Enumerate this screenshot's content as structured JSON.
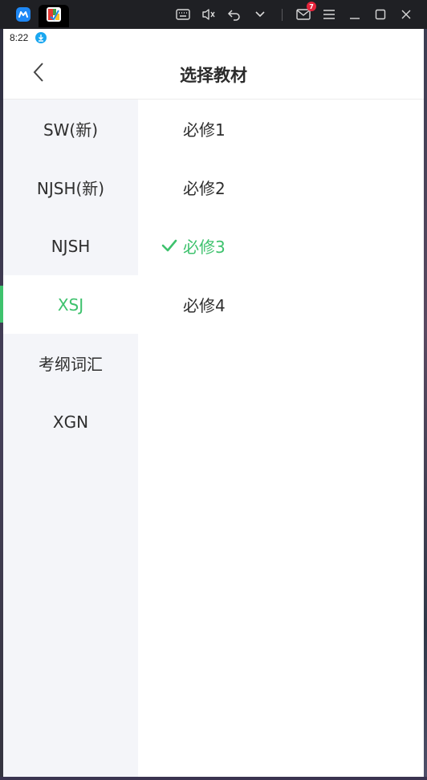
{
  "emulator": {
    "notification_count": "7"
  },
  "status_bar": {
    "time": "8:22"
  },
  "header": {
    "title": "选择教材"
  },
  "sidebar": {
    "items": [
      {
        "label": "SW(新)",
        "active": false
      },
      {
        "label": "NJSH(新)",
        "active": false
      },
      {
        "label": "NJSH",
        "active": false
      },
      {
        "label": "XSJ",
        "active": true
      },
      {
        "label": "考纲词汇",
        "active": false
      },
      {
        "label": "XGN",
        "active": false
      }
    ]
  },
  "options": {
    "items": [
      {
        "label": "必修1",
        "selected": false
      },
      {
        "label": "必修2",
        "selected": false
      },
      {
        "label": "必修3",
        "selected": true
      },
      {
        "label": "必修4",
        "selected": false
      }
    ]
  },
  "colors": {
    "accent": "#3ec26d",
    "sidebar_bg": "#f4f5f9",
    "titlebar_bg": "#1f2024",
    "badge": "#e5243b"
  }
}
